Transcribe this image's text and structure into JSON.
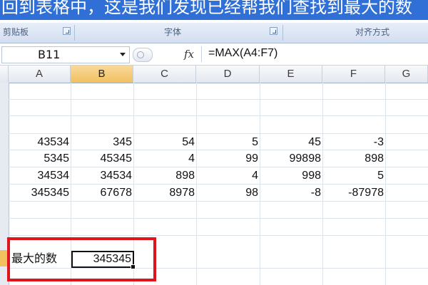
{
  "caption": "回到表格中，这是我们发现已经帮我们查找到最大的数",
  "ribbon": {
    "groups": [
      "剪贴板",
      "字体",
      "对齐方式"
    ]
  },
  "formula_bar": {
    "name_box": "B11",
    "fx_label": "fx",
    "formula": "=MAX(A4:F7)"
  },
  "columns": [
    "A",
    "B",
    "C",
    "D",
    "E",
    "F",
    "G"
  ],
  "selected_column": "B",
  "rows": [
    [
      "43534",
      "345",
      "54",
      "5",
      "45",
      "-3"
    ],
    [
      "5345",
      "45345",
      "4",
      "99",
      "99898",
      "898"
    ],
    [
      "34534",
      "34534",
      "898",
      "4",
      "998",
      "5"
    ],
    [
      "345345",
      "67678",
      "8978",
      "98",
      "-8",
      "-87978"
    ]
  ],
  "result": {
    "label": "最大的数",
    "value": "345345"
  },
  "colors": {
    "caption_bg": "#2f6fd6",
    "highlight_box": "#e0141c",
    "selected_header": "#f1c15f"
  }
}
